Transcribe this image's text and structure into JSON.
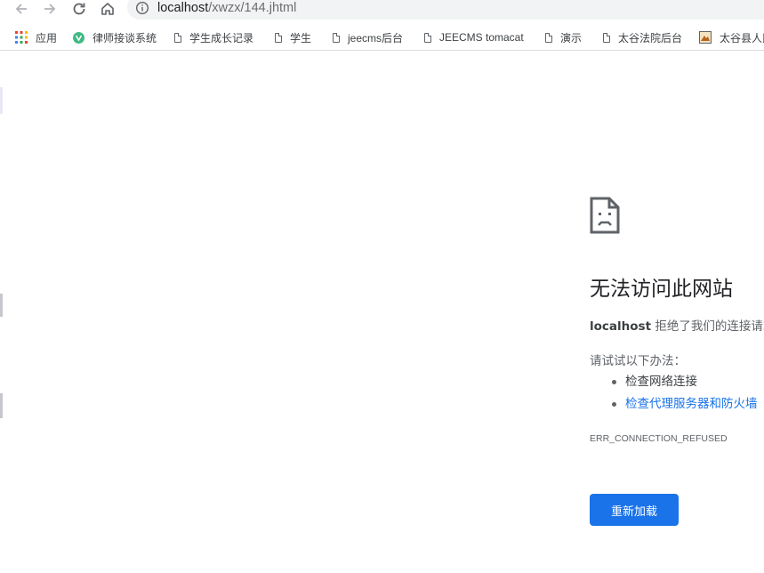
{
  "browser": {
    "url_host": "localhost",
    "url_path": "/xwzx/144.jhtml"
  },
  "bookmarks": [
    {
      "label": "应用",
      "icon": "apps-grid-icon"
    },
    {
      "label": "律师接谈系统",
      "icon": "v-logo-icon"
    },
    {
      "label": "学生成长记录",
      "icon": "page-icon"
    },
    {
      "label": "学生",
      "icon": "page-icon"
    },
    {
      "label": "jeecms后台",
      "icon": "page-icon"
    },
    {
      "label": "JEECMS tomacat",
      "icon": "page-icon"
    },
    {
      "label": "演示",
      "icon": "page-icon"
    },
    {
      "label": "太谷法院后台",
      "icon": "page-icon"
    },
    {
      "label": "太谷县人民",
      "icon": "site-favicon-icon"
    }
  ],
  "error": {
    "title": "无法访问此网站",
    "host": "localhost",
    "desc_rest": " 拒绝了我们的连接请求。",
    "try_label": "请试试以下办法：",
    "suggestions": [
      "检查网络连接",
      "检查代理服务器和防火墙"
    ],
    "code": "ERR_CONNECTION_REFUSED",
    "reload_label": "重新加载"
  },
  "colors": {
    "accent": "#1a73e8",
    "text": "#202124",
    "secondary": "#5f6368"
  }
}
